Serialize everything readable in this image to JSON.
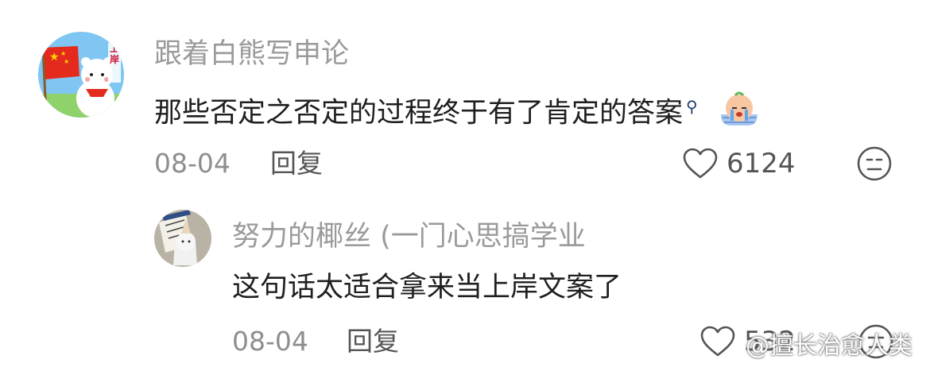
{
  "comments": [
    {
      "username": "跟着白熊写申论",
      "text": "那些否定之否定的过程终于有了肯定的答案",
      "date": "08-04",
      "reply_label": "回复",
      "likes": "6124",
      "avatar_text": "上岸"
    },
    {
      "username": "努力的椰丝 (一门心思搞学业",
      "text": "这句话太适合拿来当上岸文案了",
      "date": "08-04",
      "reply_label": "回复",
      "likes": "532"
    }
  ],
  "watermark": "@擅长治愈人类",
  "colors": {
    "username": "#9a9a9a",
    "text": "#1f1f1f",
    "meta": "#8e8e8e",
    "search_mark": "#1b3d6e"
  }
}
